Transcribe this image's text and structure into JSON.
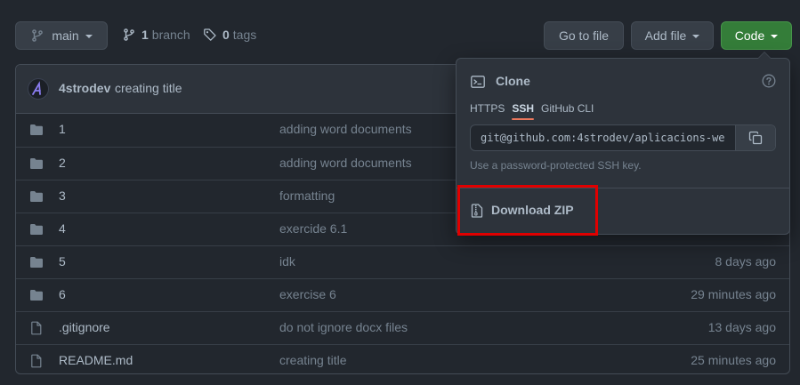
{
  "toolbar": {
    "branch_name": "main",
    "branch_count": "1",
    "branch_label": "branch",
    "tag_count": "0",
    "tag_label": "tags",
    "go_to_file": "Go to file",
    "add_file": "Add file",
    "code": "Code"
  },
  "colors": {
    "background": "#22272e",
    "code_button": "#347d39",
    "accent_tab": "#ec775c",
    "highlight": "#e00000"
  },
  "latest_commit": {
    "author": "4strodev",
    "message": "creating title"
  },
  "files": [
    {
      "name": "1",
      "type": "folder",
      "message": "adding word documents",
      "age": ""
    },
    {
      "name": "2",
      "type": "folder",
      "message": "adding word documents",
      "age": ""
    },
    {
      "name": "3",
      "type": "folder",
      "message": "formatting",
      "age": ""
    },
    {
      "name": "4",
      "type": "folder",
      "message": "exercide 6.1",
      "age": ""
    },
    {
      "name": "5",
      "type": "folder",
      "message": "idk",
      "age": "8 days ago"
    },
    {
      "name": "6",
      "type": "folder",
      "message": "exercise 6",
      "age": "29 minutes ago"
    },
    {
      "name": ".gitignore",
      "type": "file",
      "message": "do not ignore docx files",
      "age": "13 days ago"
    },
    {
      "name": "README.md",
      "type": "file",
      "message": "creating title",
      "age": "25 minutes ago"
    }
  ],
  "clone_panel": {
    "title": "Clone",
    "tabs": [
      "HTTPS",
      "SSH",
      "GitHub CLI"
    ],
    "active_tab": "SSH",
    "url": "git@github.com:4strodev/aplicacions-we",
    "hint": "Use a password-protected SSH key.",
    "download_zip": "Download ZIP"
  }
}
